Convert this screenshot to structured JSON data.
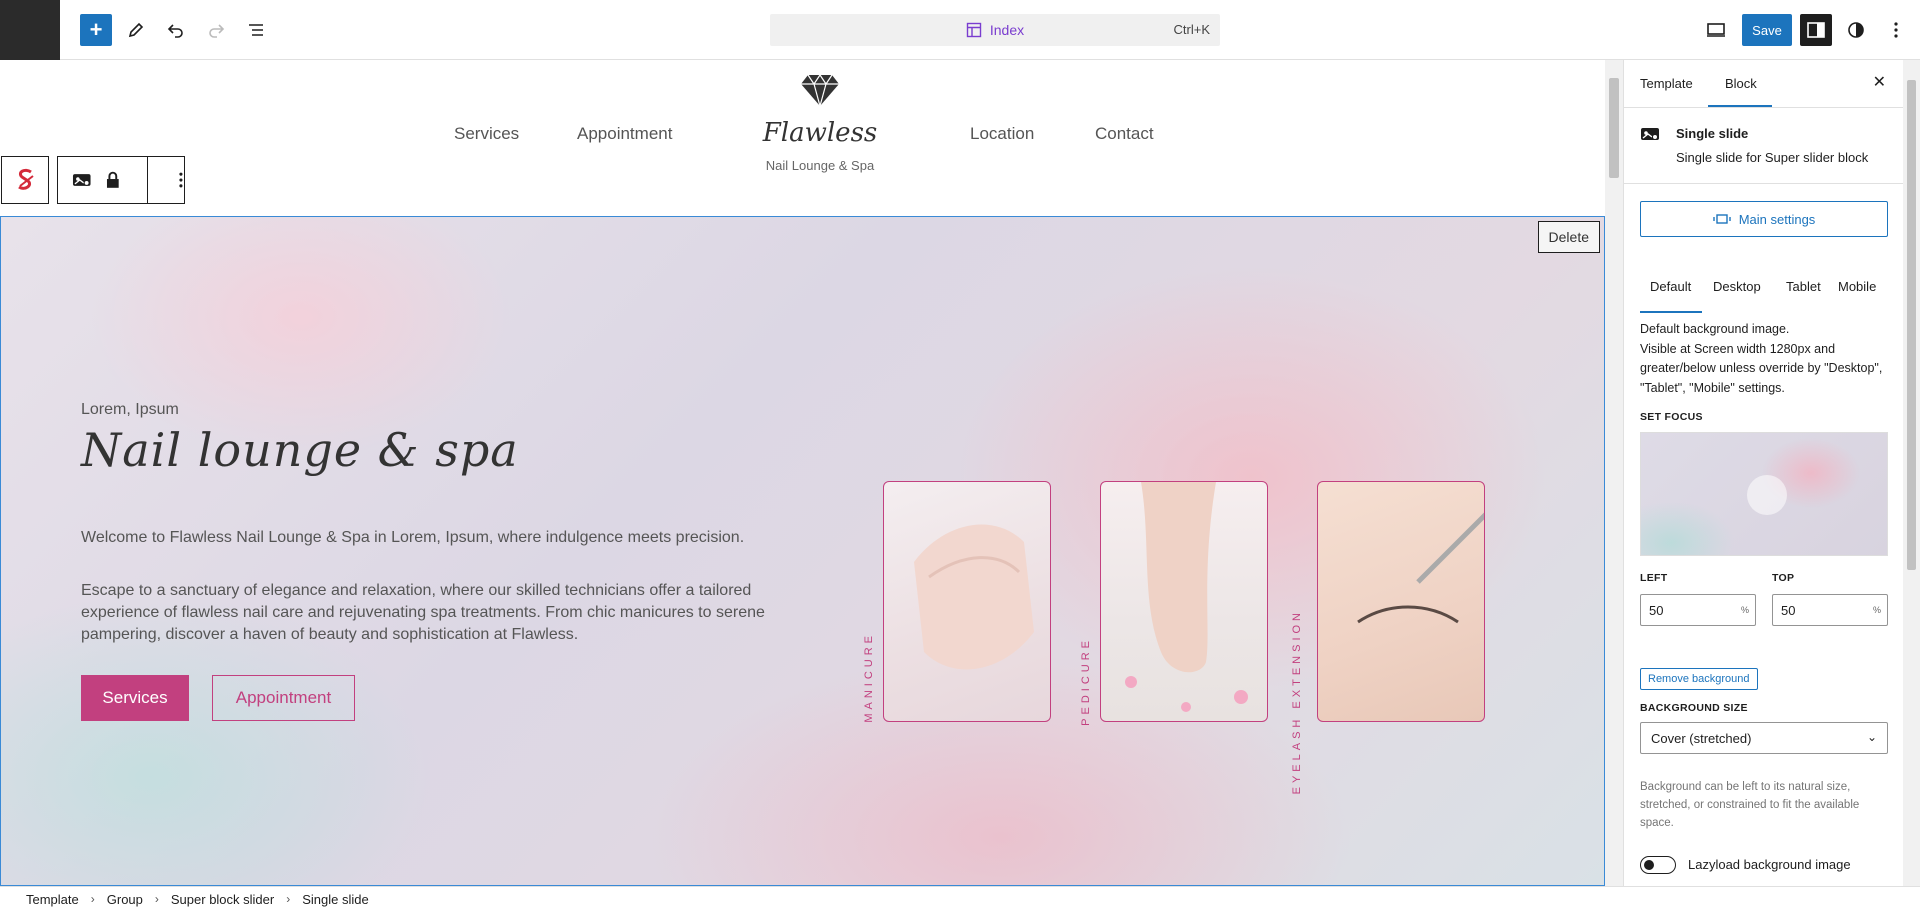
{
  "topbar": {
    "document_title": "Index",
    "shortcut": "Ctrl+K",
    "save_label": "Save"
  },
  "site": {
    "nav_left": [
      "Services",
      "Appointment"
    ],
    "nav_right": [
      "Location",
      "Contact"
    ],
    "brand_name": "Flawless",
    "brand_tagline": "Nail Lounge & Spa"
  },
  "hero": {
    "delete_label": "Delete",
    "eyebrow": "Lorem, Ipsum",
    "title": "Nail lounge & spa",
    "paragraph1": "Welcome to Flawless Nail Lounge & Spa in Lorem, Ipsum, where indulgence meets precision.",
    "paragraph2": "Escape to a sanctuary of elegance and relaxation, where our skilled technicians offer a tailored experience of flawless nail care and rejuvenating spa treatments. From chic manicures to serene pampering, discover a haven of beauty and sophistication at Flawless.",
    "btn_services": "Services",
    "btn_appointment": "Appointment",
    "cards": [
      "MANICURE",
      "PEDICURE",
      "EYELASH EXTENSION"
    ]
  },
  "breadcrumb": [
    "Template",
    "Group",
    "Super block slider",
    "Single slide"
  ],
  "panel": {
    "tab_template": "Template",
    "tab_block": "Block",
    "block_name": "Single slide",
    "block_desc": "Single slide for Super slider block",
    "main_settings": "Main settings",
    "responsive_tabs": [
      "Default",
      "Desktop",
      "Tablet",
      "Mobile"
    ],
    "bg_desc_1": "Default background image.",
    "bg_desc_2": "Visible at Screen width 1280px and greater/below unless override by \"Desktop\", \"Tablet\", \"Mobile\" settings.",
    "set_focus_label": "SET FOCUS",
    "left_label": "LEFT",
    "top_label": "TOP",
    "left_value": "50",
    "top_value": "50",
    "unit": "%",
    "remove_bg": "Remove background",
    "bg_size_label": "BACKGROUND SIZE",
    "bg_size_value": "Cover (stretched)",
    "bg_help": "Background can be left to its natural size, stretched, or constrained to fit the available space.",
    "lazyload_label": "Lazyload background image"
  }
}
